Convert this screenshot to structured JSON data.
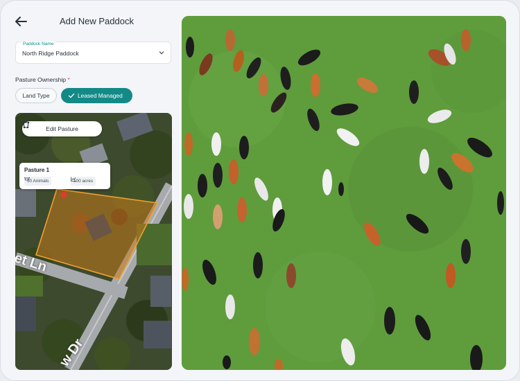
{
  "header": {
    "title": "Add New Paddock",
    "back_icon": "arrow-left-icon"
  },
  "paddock_select": {
    "label": "Paddock Name",
    "value": "North Ridge Paddock"
  },
  "ownership": {
    "label": "Pasture Ownership",
    "required_mark": "*",
    "options": [
      {
        "label": "Land Type",
        "selected": false
      },
      {
        "label": "Leased Managed",
        "selected": true,
        "icon": "check-icon"
      }
    ]
  },
  "map": {
    "edit_button": "Edit Pasture",
    "pasture": {
      "name": "Pasture 1",
      "animals": "50 Animals",
      "acres": "100 acres"
    },
    "streets": [
      "et Ln",
      "w Dr"
    ]
  },
  "colors": {
    "accent": "#138a87",
    "boundary": "#f0a030",
    "required": "#e04545"
  }
}
